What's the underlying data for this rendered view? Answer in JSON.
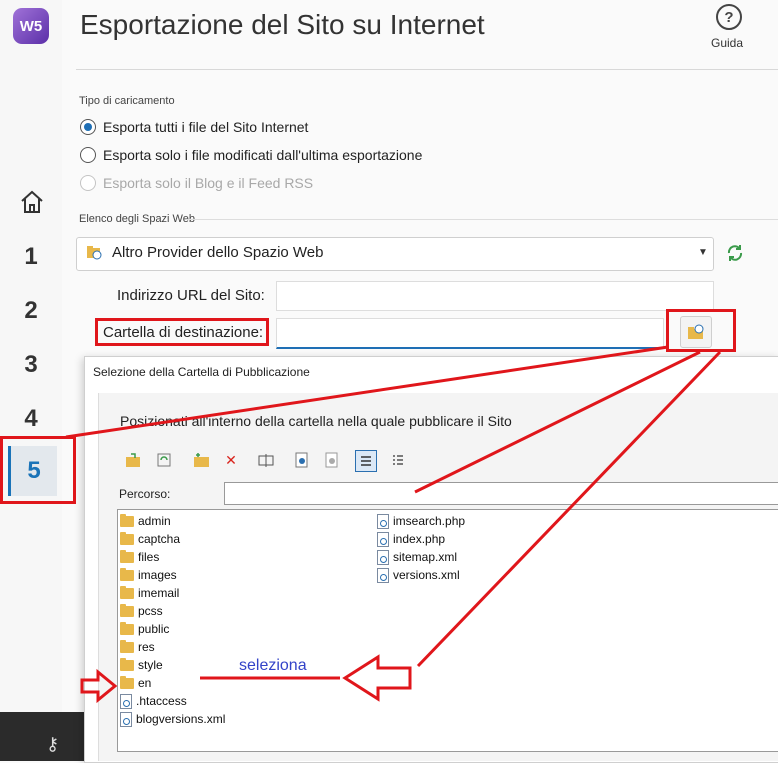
{
  "app": {
    "logo_text": "W5",
    "title": "Esportazione del Sito su Internet",
    "help_label": "Guida"
  },
  "steps": [
    "1",
    "2",
    "3",
    "4",
    "5"
  ],
  "upload": {
    "section_label": "Tipo di caricamento",
    "options": [
      {
        "label": "Esporta tutti i file del Sito Internet",
        "selected": true,
        "disabled": false
      },
      {
        "label": "Esporta solo i file modificati dall'ultima esportazione",
        "selected": false,
        "disabled": false
      },
      {
        "label": "Esporta solo il Blog e il Feed RSS",
        "selected": false,
        "disabled": true
      }
    ]
  },
  "webspaces": {
    "section_label": "Elenco degli Spazi Web",
    "selected": "Altro Provider dello Spazio Web"
  },
  "fields": {
    "url_label": "Indirizzo URL del Sito:",
    "folder_label": "Cartella di destinazione:"
  },
  "dialog": {
    "title": "Selezione della Cartella di Pubblicazione",
    "instruction": "Posizionati all'interno della cartella nella quale pubblicare il Sito",
    "path_label": "Percorso:",
    "files_col1": [
      {
        "name": "admin",
        "kind": "folder"
      },
      {
        "name": "captcha",
        "kind": "folder"
      },
      {
        "name": "files",
        "kind": "folder"
      },
      {
        "name": "images",
        "kind": "folder"
      },
      {
        "name": "imemail",
        "kind": "folder"
      },
      {
        "name": "pcss",
        "kind": "folder"
      },
      {
        "name": "public",
        "kind": "folder"
      },
      {
        "name": "res",
        "kind": "folder"
      },
      {
        "name": "style",
        "kind": "folder"
      },
      {
        "name": "en",
        "kind": "folder"
      },
      {
        "name": ".htaccess",
        "kind": "file"
      },
      {
        "name": "blogversions.xml",
        "kind": "file"
      }
    ],
    "files_col2": [
      {
        "name": "imsearch.php",
        "kind": "file"
      },
      {
        "name": "index.php",
        "kind": "file"
      },
      {
        "name": "sitemap.xml",
        "kind": "file"
      },
      {
        "name": "versions.xml",
        "kind": "file"
      }
    ]
  },
  "annotation": {
    "text": "seleziona",
    "color": "#e0161b"
  }
}
